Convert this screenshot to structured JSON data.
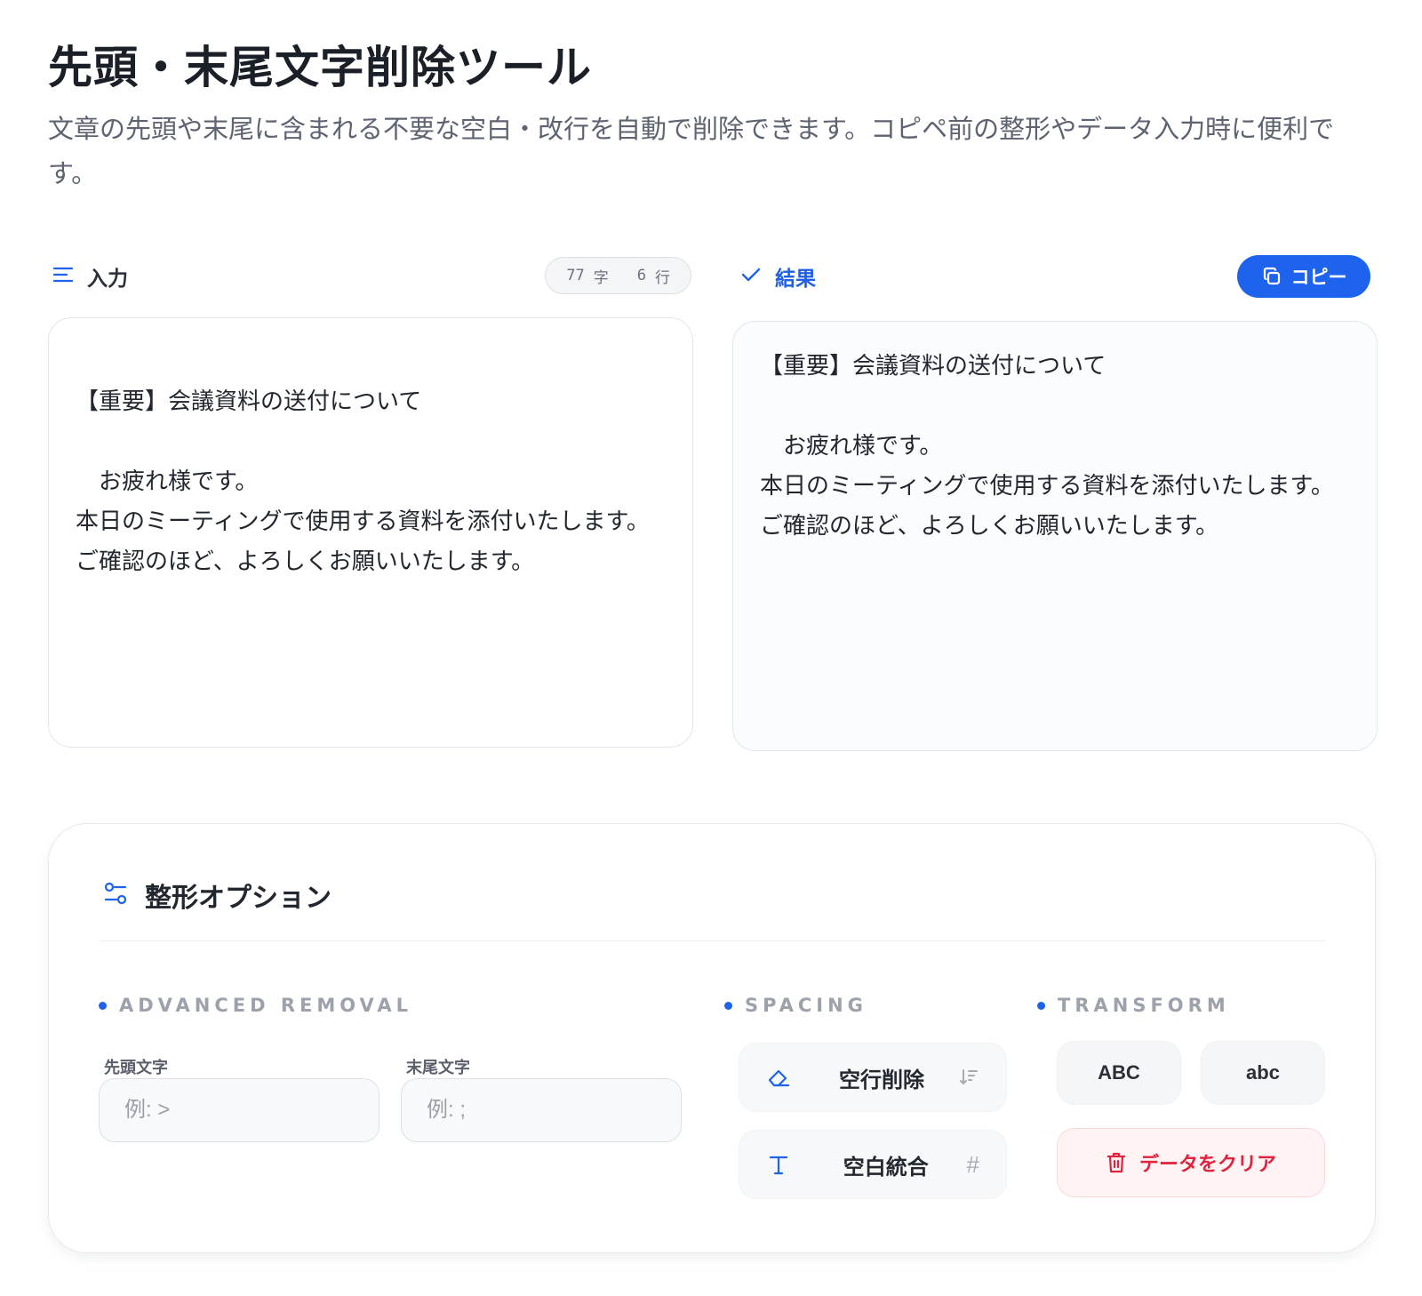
{
  "header": {
    "title": "先頭・末尾文字削除ツール",
    "description": "文章の先頭や末尾に含まれる不要な空白・改行を自動で削除できます。コピペ前の整形やデータ入力時に便利です。"
  },
  "input_panel": {
    "label": "入力",
    "counter": {
      "chars": "77",
      "chars_unit": "字",
      "lines": "6",
      "lines_unit": "行"
    },
    "text": "【重要】会議資料の送付について\n\n　お疲れ様です。\n本日のミーティングで使用する資料を添付いたします。\nご確認のほど、よろしくお願いいたします。"
  },
  "result_panel": {
    "label": "結果",
    "copy_label": "コピー",
    "text": "【重要】会議資料の送付について\n\n　お疲れ様です。\n本日のミーティングで使用する資料を添付いたします。\nご確認のほど、よろしくお願いいたします。"
  },
  "options": {
    "title": "整形オプション",
    "advanced": {
      "section_label": "ADVANCED REMOVAL",
      "prefix_label": "先頭文字",
      "prefix_placeholder": "例: >",
      "suffix_label": "末尾文字",
      "suffix_placeholder": "例: ;"
    },
    "spacing": {
      "section_label": "SPACING",
      "remove_blank_lines": "空行削除",
      "merge_spaces": "空白統合",
      "merge_spaces_trail": "#"
    },
    "transform": {
      "section_label": "TRANSFORM",
      "uppercase": "ABC",
      "lowercase": "abc",
      "clear_label": "データをクリア"
    }
  },
  "colors": {
    "accent": "#1d63ee",
    "danger": "#e0233f",
    "danger_bg": "#fff3f4"
  }
}
